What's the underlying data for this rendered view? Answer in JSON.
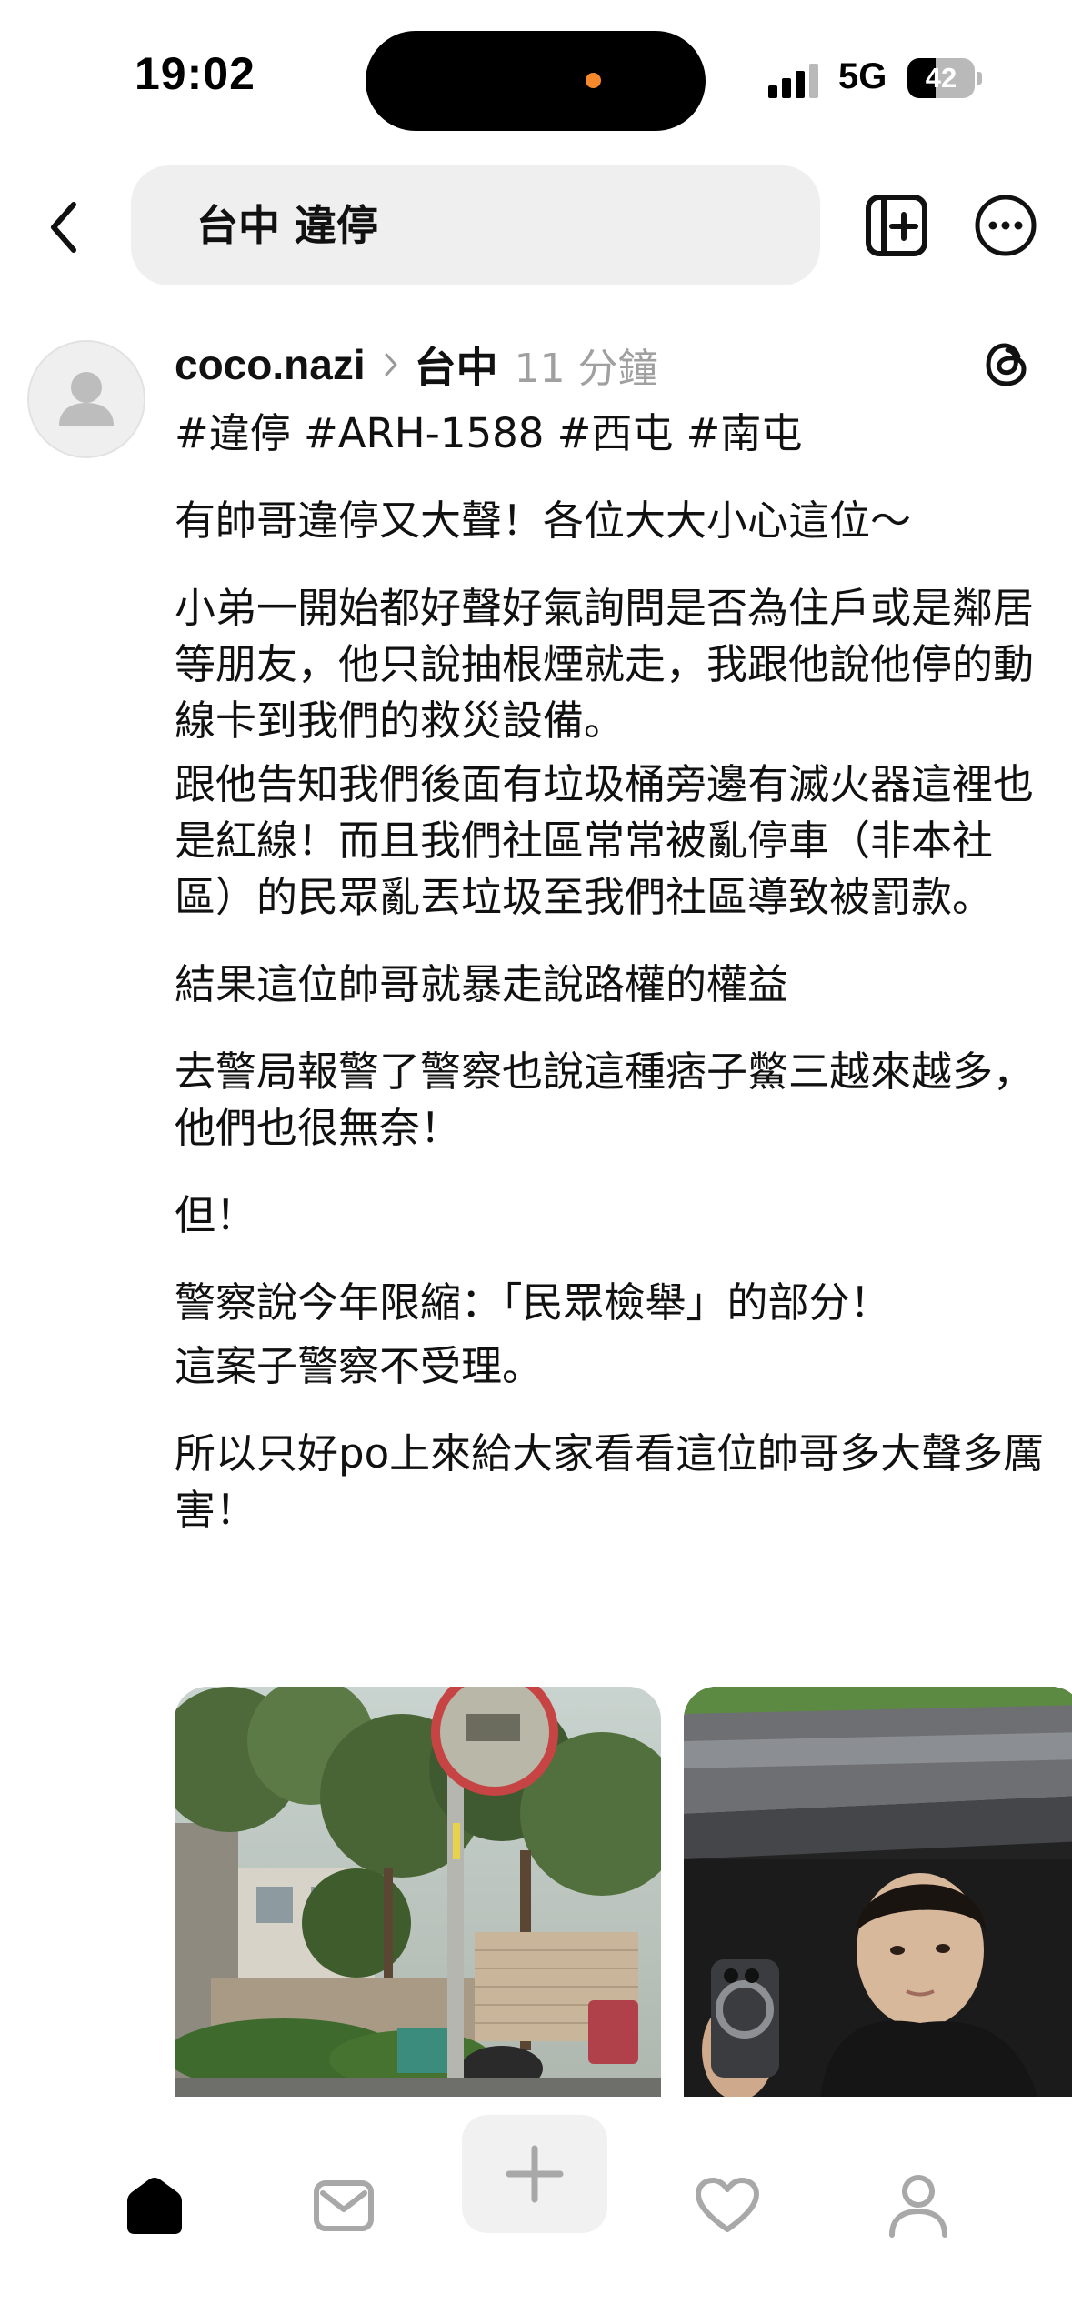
{
  "status_bar": {
    "time": "19:02",
    "network": "5G",
    "battery_level": "42",
    "battery_fraction": 0.42
  },
  "header": {
    "search_query": "台中 違停",
    "icons": [
      "back-chevron-icon",
      "compose-panel-icon",
      "more-dots-icon"
    ]
  },
  "post": {
    "author": "coco.nazi",
    "topic": "台中",
    "time_ago": "11 分鐘",
    "hashtags": "#違停 #ARH-1588 #西屯 #南屯",
    "paragraphs": [
      "有帥哥違停又大聲！各位大大小心這位～",
      "小弟一開始都好聲好氣詢問是否為住戶或是鄰居等朋友，他只說抽根煙就走，我跟他說他停的動線卡到我們的救災設備。",
      "跟他告知我們後面有垃圾桶旁邊有滅火器這裡也是紅線！而且我們社區常常被亂停車（非本社區）的民眾亂丟垃圾至我們社區導致被罰款。",
      "結果這位帥哥就暴走說路權的權益",
      "去警局報警了警察也說這種痞子鱉三越來越多，他們也很無奈！",
      "但！",
      "警察說今年限縮：「民眾檢舉」的部分！",
      "這案子警察不受理。",
      "所以只好po上來給大家看看這位帥哥多大聲多厲害！"
    ],
    "images": [
      "street-mirror-photo",
      "man-in-car-photo"
    ]
  },
  "bottom_nav": {
    "items": [
      "home-icon",
      "messages-icon",
      "create-plus-icon",
      "activity-heart-icon",
      "profile-icon"
    ],
    "active": "home-icon"
  },
  "colors": {
    "text": "#111111",
    "muted": "#a0a0a0",
    "search_bg": "#efefef",
    "island_dot": "#f5892b"
  }
}
